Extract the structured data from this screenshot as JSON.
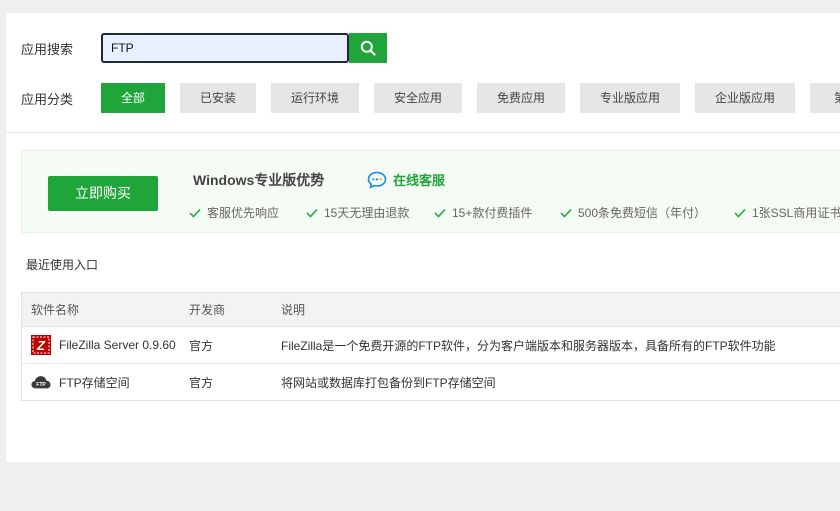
{
  "search": {
    "label": "应用搜索",
    "value": "FTP"
  },
  "categories": {
    "label": "应用分类",
    "items": [
      "全部",
      "已安装",
      "运行环境",
      "安全应用",
      "免费应用",
      "专业版应用",
      "企业版应用",
      "第"
    ],
    "active_index": 0
  },
  "promo": {
    "buy_label": "立即购买",
    "title": "Windows专业版优势",
    "service_label": "在线客服",
    "benefits": [
      "客服优先响应",
      "15天无理由退款",
      "15+款付费插件",
      "500条免费短信（年付）",
      "1张SSL商用证书"
    ]
  },
  "recent_label": "最近使用入口",
  "table": {
    "headers": [
      "软件名称",
      "开发商",
      "说明"
    ],
    "rows": [
      {
        "name": "FileZilla Server 0.9.60",
        "vendor": "官方",
        "desc": "FileZilla是一个免费开源的FTP软件，分为客户端版本和服务器版本，具备所有的FTP软件功能",
        "icon": "filezilla-icon"
      },
      {
        "name": "FTP存储空间",
        "vendor": "官方",
        "desc": "将网站或数据库打包备份到FTP存储空间",
        "icon": "ftp-cloud-icon"
      }
    ]
  },
  "colors": {
    "accent": "#20a53a",
    "filezilla_red": "#bf0000"
  }
}
